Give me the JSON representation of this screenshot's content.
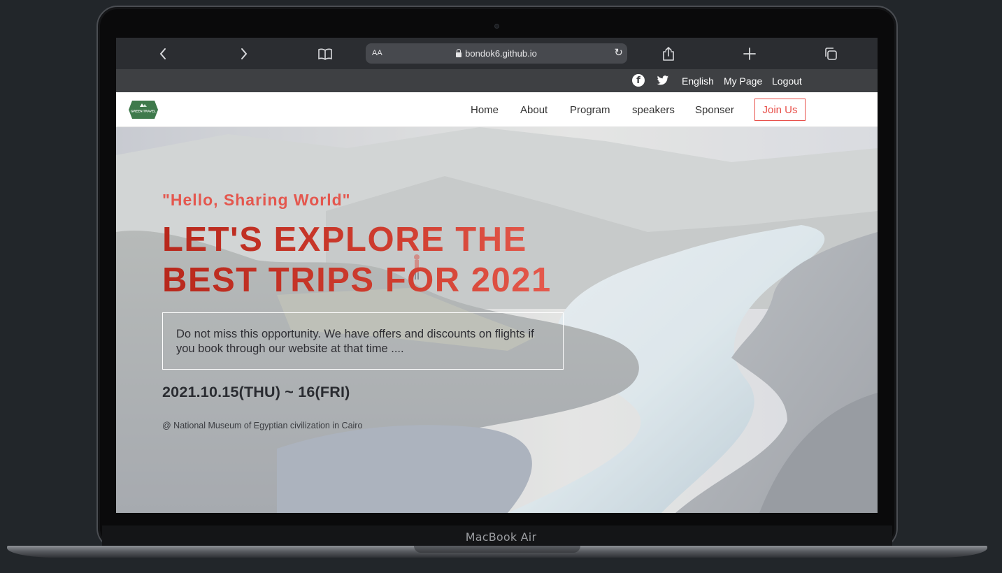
{
  "device": {
    "brand": "MacBook Air"
  },
  "browser": {
    "url": "bondok6.github.io",
    "reader_label": "AA",
    "icons": [
      "chevron-left-icon",
      "chevron-right-icon",
      "book-icon",
      "lock-icon",
      "reload-icon",
      "share-icon",
      "plus-icon",
      "tabs-icon"
    ]
  },
  "topbar": {
    "language": "English",
    "my_page": "My Page",
    "logout": "Logout"
  },
  "nav": {
    "logo_text": "GREEN TRAVEL",
    "items": [
      "Home",
      "About",
      "Program",
      "speakers",
      "Sponser"
    ],
    "join": "Join Us"
  },
  "hero": {
    "tagline": "\"Hello, Sharing World\"",
    "headline_line1": "LET'S EXPLORE THE",
    "headline_line2": "BEST TRIPS FOR 2021",
    "description": "Do not miss this opportunity. We have offers and discounts on flights if you book through our website at that time ....",
    "date": "2021.10.15(THU) ~ 16(FRI)",
    "venue": "@ National Museum of Egyptian civilization in Cairo"
  },
  "colors": {
    "accent": "#e8504a",
    "headline": "#c0392b",
    "topbar_bg": "#3e4043",
    "logo_green": "#3f7a4c"
  }
}
